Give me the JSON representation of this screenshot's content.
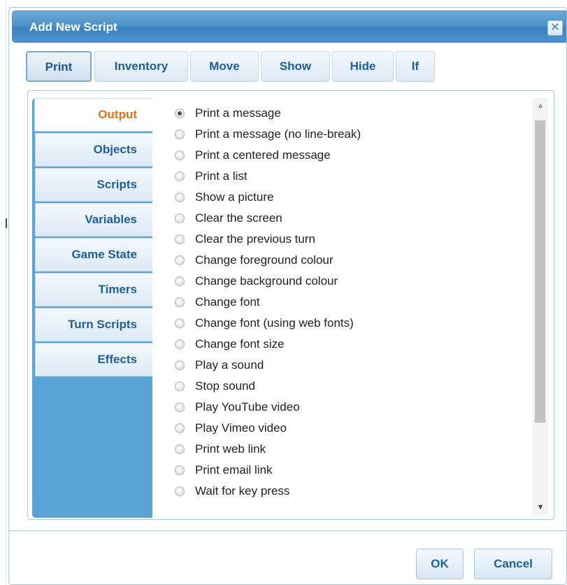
{
  "dialog": {
    "title": "Add New Script",
    "close_icon": "close-x-icon"
  },
  "tabs": [
    {
      "label": "Print",
      "active": true
    },
    {
      "label": "Inventory",
      "active": false
    },
    {
      "label": "Move",
      "active": false
    },
    {
      "label": "Show",
      "active": false
    },
    {
      "label": "Hide",
      "active": false
    },
    {
      "label": "If",
      "active": false
    }
  ],
  "categories": [
    {
      "label": "Output",
      "active": true
    },
    {
      "label": "Objects",
      "active": false
    },
    {
      "label": "Scripts",
      "active": false
    },
    {
      "label": "Variables",
      "active": false
    },
    {
      "label": "Game State",
      "active": false
    },
    {
      "label": "Timers",
      "active": false
    },
    {
      "label": "Turn Scripts",
      "active": false
    },
    {
      "label": "Effects",
      "active": false
    }
  ],
  "options": [
    {
      "label": "Print a message",
      "selected": true
    },
    {
      "label": "Print a message (no line-break)",
      "selected": false
    },
    {
      "label": "Print a centered message",
      "selected": false
    },
    {
      "label": "Print a list",
      "selected": false
    },
    {
      "label": "Show a picture",
      "selected": false
    },
    {
      "label": "Clear the screen",
      "selected": false
    },
    {
      "label": "Clear the previous turn",
      "selected": false
    },
    {
      "label": "Change foreground colour",
      "selected": false
    },
    {
      "label": "Change background colour",
      "selected": false
    },
    {
      "label": "Change font",
      "selected": false
    },
    {
      "label": "Change font (using web fonts)",
      "selected": false
    },
    {
      "label": "Change font size",
      "selected": false
    },
    {
      "label": "Play a sound",
      "selected": false
    },
    {
      "label": "Stop sound",
      "selected": false
    },
    {
      "label": "Play YouTube video",
      "selected": false
    },
    {
      "label": "Play Vimeo video",
      "selected": false
    },
    {
      "label": "Print web link",
      "selected": false
    },
    {
      "label": "Print email link",
      "selected": false
    },
    {
      "label": "Wait for key press",
      "selected": false
    }
  ],
  "buttons": {
    "ok": "OK",
    "cancel": "Cancel"
  },
  "colors": {
    "titlebar": "#4f93cb",
    "sidebar": "#5ba4d6",
    "active_category_text": "#e0721f",
    "tab_text": "#1e5f94"
  }
}
